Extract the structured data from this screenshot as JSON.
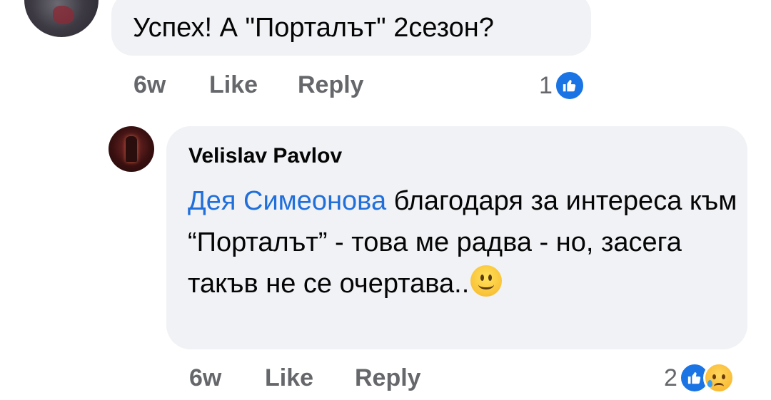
{
  "top_comment": {
    "text": "Успех! А \"Порталът\" 2сезон?",
    "actions": {
      "time": "6w",
      "like": "Like",
      "reply": "Reply"
    },
    "reactions": {
      "count": "1",
      "icons": [
        "like-icon"
      ]
    }
  },
  "reply_comment": {
    "author": "Velislav Pavlov",
    "mention": "Дея Симеонова",
    "text_after_mention": " благодаря за интереса към “Порталът” - това ме радва - но, засега такъв не се очертава..",
    "emoji": "smiling-face-icon",
    "actions": {
      "time": "6w",
      "like": "Like",
      "reply": "Reply"
    },
    "reactions": {
      "count": "2",
      "icons": [
        "like-icon",
        "sad-icon"
      ]
    }
  },
  "colors": {
    "bubble": "#f0f2f5",
    "mention": "#216fdb",
    "meta_text": "#65676b",
    "like_blue": "#1b74e4"
  }
}
